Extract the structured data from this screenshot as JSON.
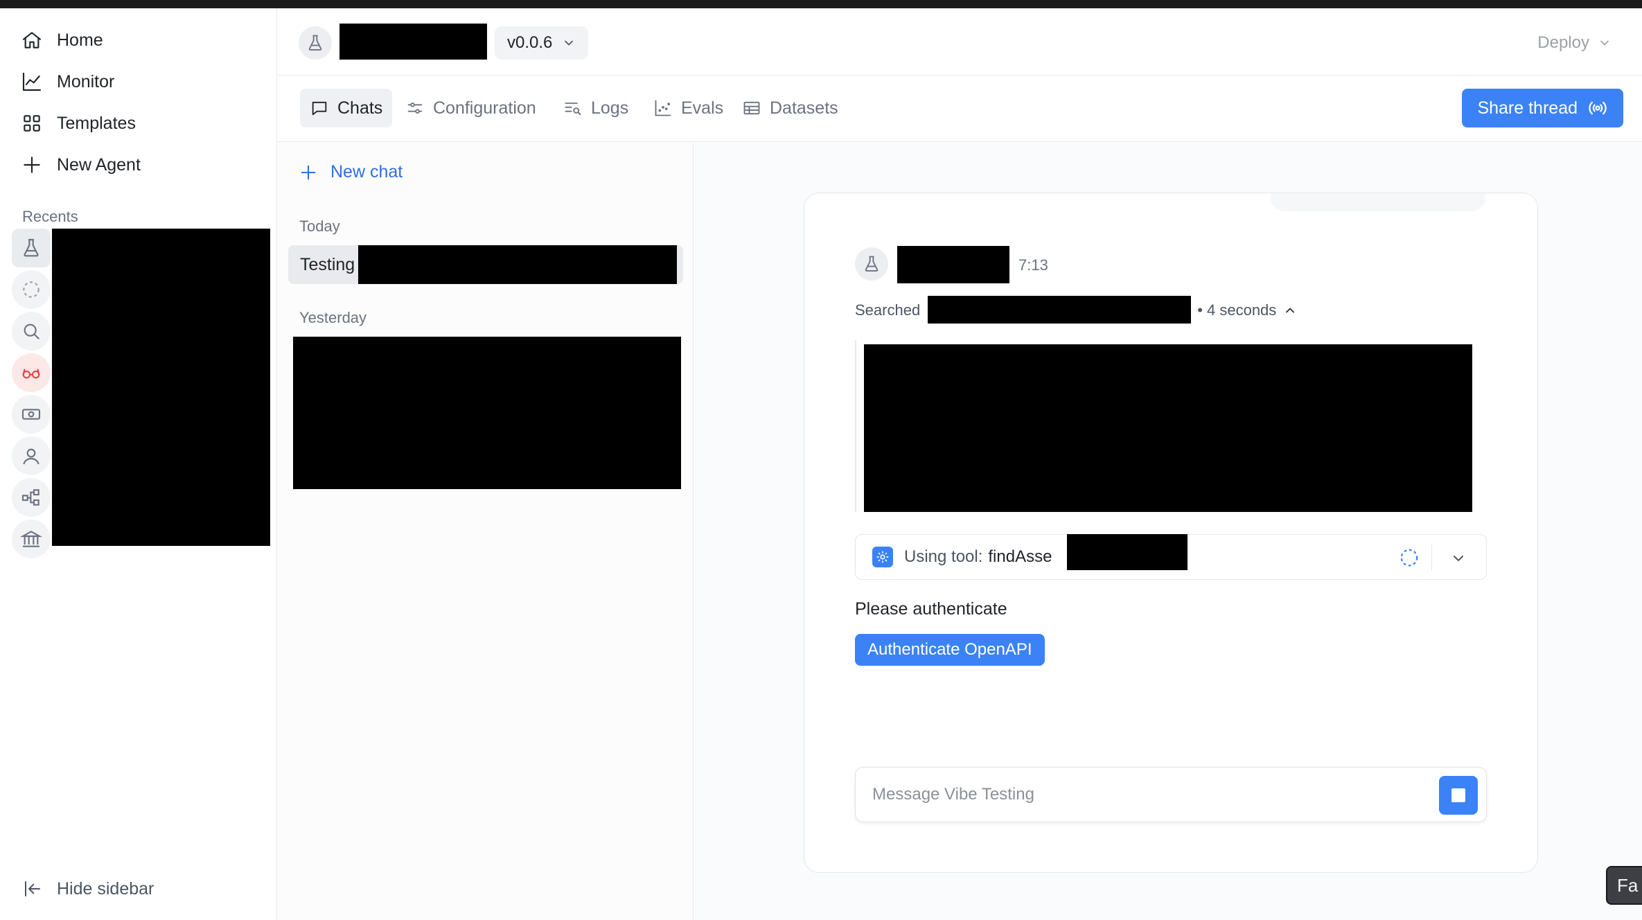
{
  "sidebar": {
    "nav": [
      {
        "label": "Home",
        "icon": "home-icon"
      },
      {
        "label": "Monitor",
        "icon": "chart-line-icon"
      },
      {
        "label": "Templates",
        "icon": "grid-icon"
      },
      {
        "label": "New Agent",
        "icon": "plus-icon"
      }
    ],
    "recents_label": "Recents",
    "recent_icons": [
      "flask-icon",
      "dashed-circle-icon",
      "search-icon",
      "glasses-icon",
      "cash-icon",
      "user-icon",
      "flow-icon",
      "bank-icon"
    ],
    "hide_label": "Hide sidebar"
  },
  "header": {
    "version": "v0.0.6",
    "deploy": "Deploy"
  },
  "tabs": [
    {
      "label": "Chats",
      "icon": "chat-bubble-icon",
      "active": true
    },
    {
      "label": "Configuration",
      "icon": "sliders-icon",
      "active": false
    },
    {
      "label": "Logs",
      "icon": "logs-icon",
      "active": false
    },
    {
      "label": "Evals",
      "icon": "scatter-icon",
      "active": false
    },
    {
      "label": "Datasets",
      "icon": "table-icon",
      "active": false
    }
  ],
  "share_label": "Share thread",
  "chatlist": {
    "new_chat": "New chat",
    "today": "Today",
    "today_item": "Testing",
    "yesterday": "Yesterday"
  },
  "conversation": {
    "time": "7:13",
    "searched_label": "Searched",
    "duration": "• 4 seconds",
    "tool_prefix": "Using tool:",
    "tool_name": "findAsse",
    "please_auth": "Please authenticate",
    "auth_button": "Authenticate OpenAPI",
    "composer_placeholder": "Message Vibe Testing"
  },
  "corner_tab": "Fa",
  "colors": {
    "accent": "#3b82f6",
    "link": "#2f6fe4"
  }
}
